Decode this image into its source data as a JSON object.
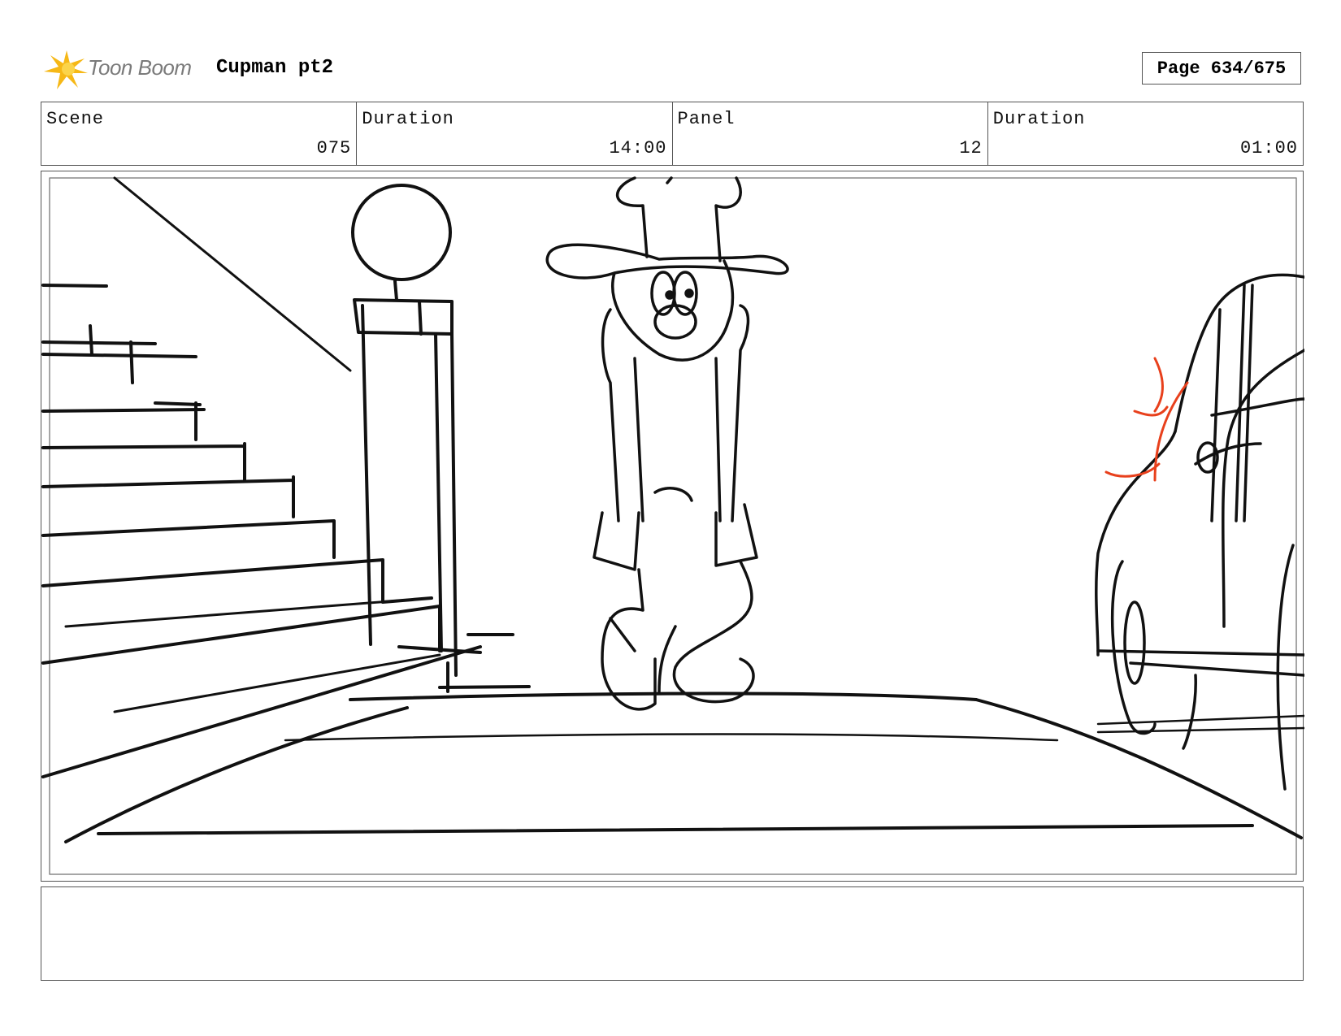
{
  "header": {
    "logo_text": "Toon Boom",
    "title": "Cupman pt2",
    "page_label": "Page 634/675"
  },
  "info": {
    "scene": {
      "label": "Scene",
      "value": "075"
    },
    "scene_duration": {
      "label": "Duration",
      "value": "14:00"
    },
    "panel": {
      "label": "Panel",
      "value": "12"
    },
    "panel_duration": {
      "label": "Duration",
      "value": "01:00"
    }
  },
  "panel_image": {
    "icon": "storyboard-sketch",
    "accent_color": "#e8401c"
  },
  "notes": {
    "text": ""
  }
}
